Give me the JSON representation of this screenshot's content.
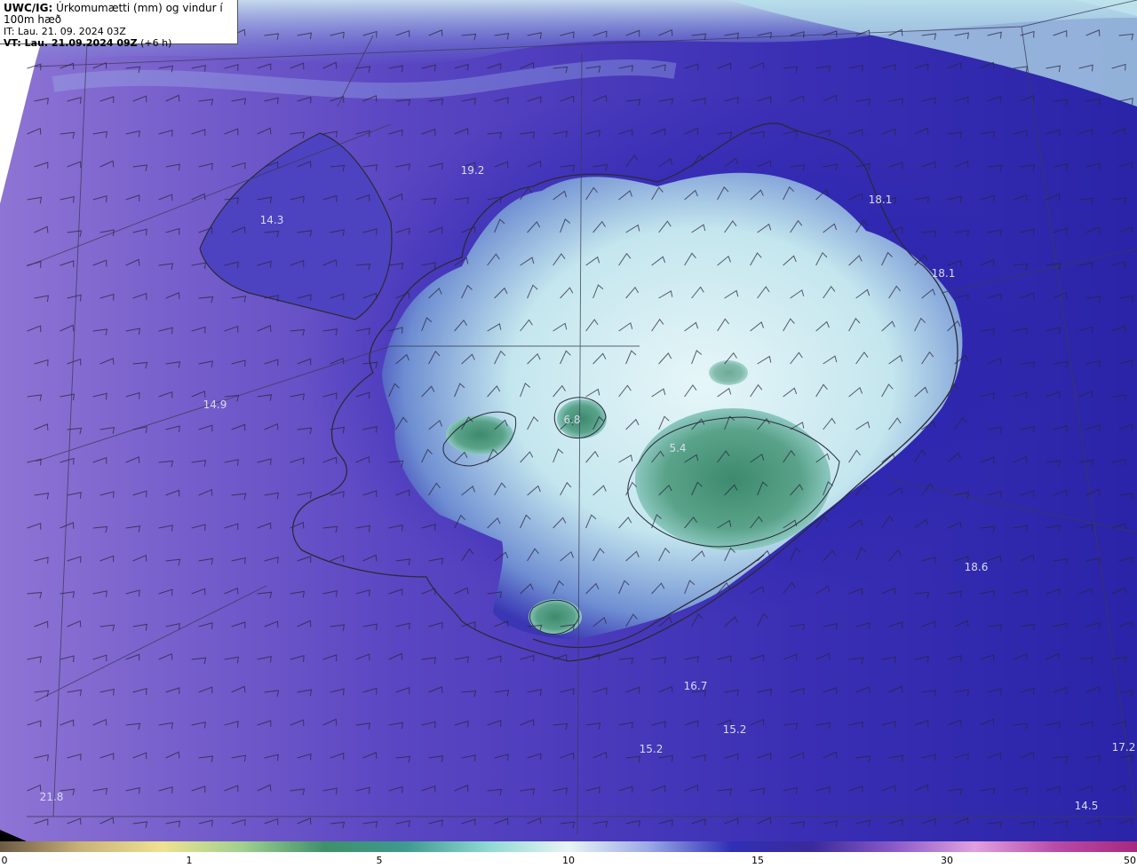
{
  "header": {
    "model": "UWC/IG:",
    "product": "Úrkomumætti (mm) og vindur í 100m hæð",
    "issue_time": "IT: Lau. 21. 09. 2024 03Z",
    "valid_prefix": "VT: Lau. 21.09.2024 09Z",
    "valid_suffix": "(+6 h)"
  },
  "labels": [
    {
      "id": "a",
      "text": "19.2"
    },
    {
      "id": "b",
      "text": "14.3"
    },
    {
      "id": "c",
      "text": "18.1"
    },
    {
      "id": "d",
      "text": "18.1"
    },
    {
      "id": "e",
      "text": "14.9"
    },
    {
      "id": "f",
      "text": "6.8"
    },
    {
      "id": "g",
      "text": "5.4"
    },
    {
      "id": "h",
      "text": "18.6"
    },
    {
      "id": "i",
      "text": "16.7"
    },
    {
      "id": "j",
      "text": "15.2"
    },
    {
      "id": "k",
      "text": "15.2"
    },
    {
      "id": "l",
      "text": "17.2"
    },
    {
      "id": "m",
      "text": "21.8"
    },
    {
      "id": "n",
      "text": "14.5"
    }
  ],
  "colorbar": {
    "ticks": [
      "0",
      "1",
      "5",
      "10",
      "15",
      "30",
      "50"
    ],
    "colors": [
      "#6b5a44",
      "#c9b27a",
      "#efe28f",
      "#9fcf8f",
      "#3f8f6a",
      "#3f9a8f",
      "#8fd8d2",
      "#e8f4f6",
      "#9aa8e6",
      "#2f2fb6",
      "#3a2a9a",
      "#8a5ac8",
      "#e0a0e0",
      "#b84aa8",
      "#a8287e"
    ]
  },
  "palette": {
    "ocean_light": "#8a6fd0",
    "ocean_mid": "#4b3db8",
    "ocean_deep": "#1d1aa4",
    "north_band": "#b8d8e8",
    "land_inner": "#dff2f6",
    "land_mid": "#7fa8d8",
    "green": "#3f8a72",
    "coast": "#2a2a3a"
  }
}
